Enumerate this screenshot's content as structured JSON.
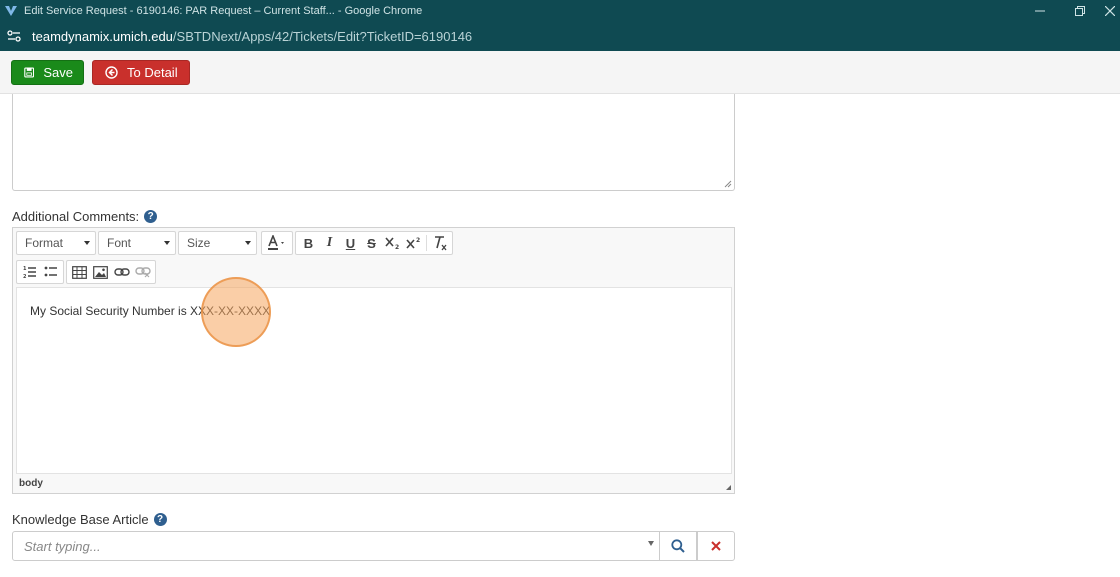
{
  "window": {
    "title": "Edit Service Request - 6190146: PAR Request – Current Staff... - Google Chrome"
  },
  "address": {
    "domain": "teamdynamix.umich.edu",
    "path": "/SBTDNext/Apps/42/Tickets/Edit?TicketID=6190146"
  },
  "toolbar": {
    "save_label": "Save",
    "detail_label": "To Detail"
  },
  "additional_comments": {
    "label": "Additional Comments:",
    "help": "?"
  },
  "editor": {
    "format_label": "Format",
    "font_label": "Font",
    "size_label": "Size",
    "bold": "B",
    "italic": "I",
    "underline": "U",
    "strike": "S",
    "content": "My Social Security Number is XXX-XX-XXXX",
    "status": "body"
  },
  "kb": {
    "label": "Knowledge Base Article",
    "help": "?",
    "placeholder": "Start typing..."
  },
  "colors": {
    "chrome_bar": "#0f4a52",
    "save": "#1a8a1a",
    "detail": "#c9302c",
    "help": "#2f5f8f",
    "click_marker": "#f6a65e"
  }
}
